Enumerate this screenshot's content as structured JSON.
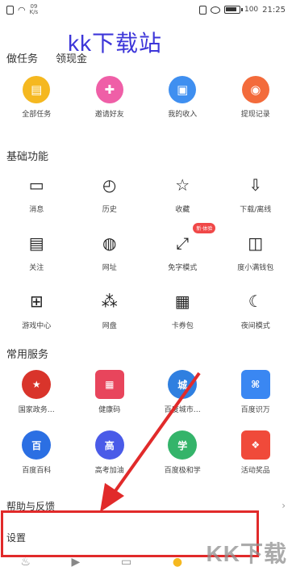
{
  "status_bar": {
    "net_speed_value": "09",
    "net_speed_unit": "K/s",
    "battery": "100",
    "time": "21:25"
  },
  "watermark": {
    "text": "kk下载站"
  },
  "tabs": [
    {
      "label": "做任务"
    },
    {
      "label": "领现金"
    }
  ],
  "tasks": [
    {
      "label": "全部任务",
      "color": "#f5b820",
      "glyph": "▤"
    },
    {
      "label": "邀请好友",
      "color": "#ef5fa7",
      "glyph": "✚"
    },
    {
      "label": "我的收入",
      "color": "#3f8ff0",
      "glyph": "▣"
    },
    {
      "label": "提现记录",
      "color": "#f36b3b",
      "glyph": "◉"
    }
  ],
  "basic_section": {
    "title": "基础功能",
    "items": [
      {
        "label": "消息",
        "glyph": "▭",
        "icon": "message-icon"
      },
      {
        "label": "历史",
        "glyph": "◴",
        "icon": "clock-icon"
      },
      {
        "label": "收藏",
        "glyph": "☆",
        "icon": "star-icon"
      },
      {
        "label": "下载/离线",
        "glyph": "⇩",
        "icon": "download-icon"
      },
      {
        "label": "关注",
        "glyph": "▤",
        "icon": "follow-icon"
      },
      {
        "label": "网址",
        "glyph": "◍",
        "icon": "globe-icon"
      },
      {
        "label": "免字模式",
        "glyph": "⤢",
        "icon": "mode-icon",
        "badge": "新·体验"
      },
      {
        "label": "度小满钱包",
        "glyph": "◫",
        "icon": "wallet-icon"
      },
      {
        "label": "游戏中心",
        "glyph": "⊞",
        "icon": "gamepad-icon"
      },
      {
        "label": "网盘",
        "glyph": "⁂",
        "icon": "cloud-disk-icon"
      },
      {
        "label": "卡券包",
        "glyph": "▦",
        "icon": "coupon-icon"
      },
      {
        "label": "夜间模式",
        "glyph": "☾",
        "icon": "moon-icon"
      }
    ]
  },
  "services_section": {
    "title": "常用服务",
    "items": [
      {
        "label": "国家政务…",
        "color": "#d9342b",
        "glyph": "★"
      },
      {
        "label": "健康码",
        "color": "#e8455c",
        "glyph": "▦"
      },
      {
        "label": "百度城市…",
        "color": "#2f7fe0",
        "glyph": "城"
      },
      {
        "label": "百度识万",
        "color": "#3a87f2",
        "glyph": "⌘"
      },
      {
        "label": "百度百科",
        "color": "#2b6fe3",
        "glyph": "百"
      },
      {
        "label": "高考加油",
        "color": "#4a5be8",
        "glyph": "高"
      },
      {
        "label": "百度极和学",
        "color": "#34b46a",
        "glyph": "学"
      },
      {
        "label": "活动奖品",
        "color": "#f04a3a",
        "glyph": "❖"
      }
    ]
  },
  "help": {
    "label": "帮助与反馈",
    "arrow": "›"
  },
  "settings": {
    "label": "设置"
  },
  "corner_logo": {
    "text": "KK下载"
  }
}
